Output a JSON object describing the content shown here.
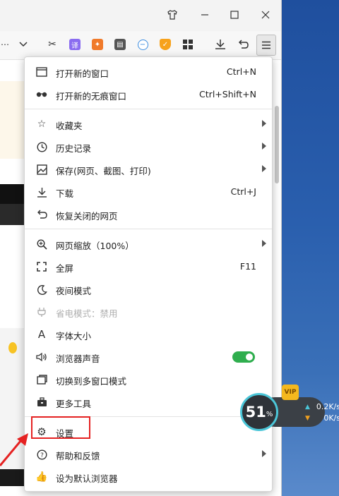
{
  "toolbar": {
    "ext_translate": "译"
  },
  "menu": {
    "items": [
      {
        "label": "打开新的窗口",
        "shortcut": "Ctrl+N"
      },
      {
        "label": "打开新的无痕窗口",
        "shortcut": "Ctrl+Shift+N"
      },
      {
        "label": "收藏夹"
      },
      {
        "label": "历史记录"
      },
      {
        "label": "保存(网页、截图、打印)"
      },
      {
        "label": "下载",
        "shortcut": "Ctrl+J"
      },
      {
        "label": "恢复关闭的网页"
      },
      {
        "label": "网页缩放（100%）"
      },
      {
        "label": "全屏",
        "shortcut": "F11"
      },
      {
        "label": "夜间模式"
      },
      {
        "label": "省电模式：禁用"
      },
      {
        "label": "字体大小"
      },
      {
        "label": "浏览器声音"
      },
      {
        "label": "切换到多窗口模式"
      },
      {
        "label": "更多工具"
      },
      {
        "label": "设置"
      },
      {
        "label": "帮助和反馈"
      },
      {
        "label": "设为默认浏览器"
      }
    ]
  },
  "speed_widget": {
    "percent": "51",
    "percent_unit": "%",
    "upload": "0.2K/s",
    "download": "0K/s",
    "vip_badge": "VIP"
  },
  "colors": {
    "toggle_on": "#2fae4e",
    "highlight_box": "#e52222",
    "ring": "#4bc6d8"
  }
}
